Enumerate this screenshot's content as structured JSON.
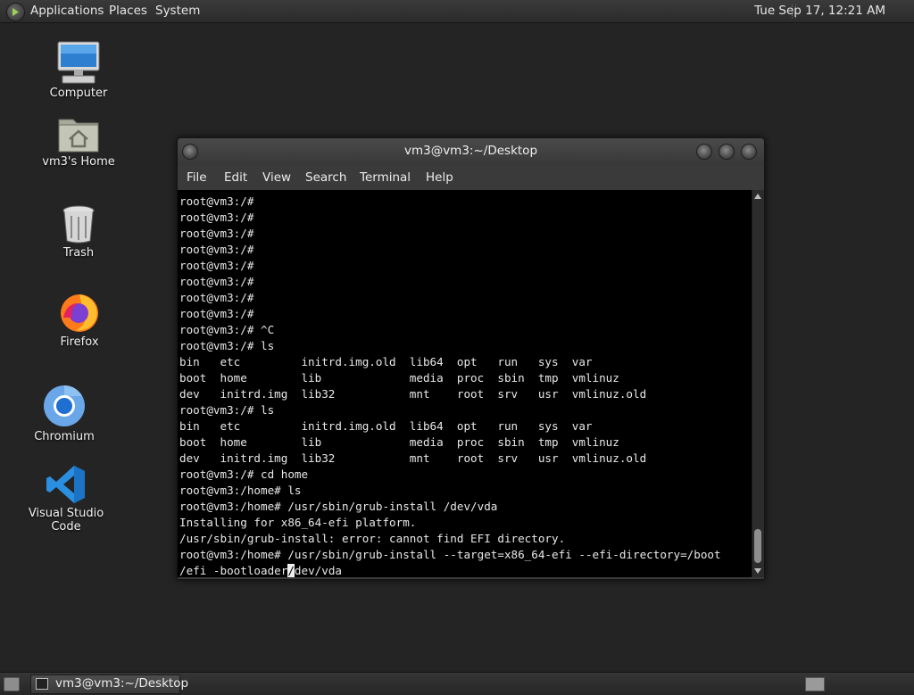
{
  "top_panel": {
    "menus": [
      "Applications",
      "Places",
      "System"
    ],
    "clock": "Tue Sep 17, 12:21 AM"
  },
  "desktop": {
    "icons": [
      {
        "label": "Computer",
        "icon": "computer-icon"
      },
      {
        "label": "vm3's Home",
        "icon": "home-folder-icon"
      },
      {
        "label": "Trash",
        "icon": "trash-icon"
      },
      {
        "label": "Firefox",
        "icon": "firefox-icon"
      },
      {
        "label": "Chromium",
        "icon": "chromium-icon"
      },
      {
        "label": "Visual Studio Code",
        "icon": "vscode-icon"
      }
    ]
  },
  "terminal": {
    "title": "vm3@vm3:~/Desktop",
    "menu": [
      "File",
      "Edit",
      "View",
      "Search",
      "Terminal",
      "Help"
    ],
    "lines": [
      "root@vm3:/#",
      "root@vm3:/#",
      "root@vm3:/#",
      "root@vm3:/#",
      "root@vm3:/#",
      "root@vm3:/#",
      "root@vm3:/#",
      "root@vm3:/#",
      "root@vm3:/# ^C",
      "root@vm3:/# ls",
      "bin   etc         initrd.img.old  lib64  opt   run   sys  var",
      "boot  home        lib             media  proc  sbin  tmp  vmlinuz",
      "dev   initrd.img  lib32           mnt    root  srv   usr  vmlinuz.old",
      "root@vm3:/# ls",
      "bin   etc         initrd.img.old  lib64  opt   run   sys  var",
      "boot  home        lib             media  proc  sbin  tmp  vmlinuz",
      "dev   initrd.img  lib32           mnt    root  srv   usr  vmlinuz.old",
      "root@vm3:/# cd home",
      "root@vm3:/home# ls",
      "root@vm3:/home# /usr/sbin/grub-install /dev/vda",
      "Installing for x86_64-efi platform.",
      "/usr/sbin/grub-install: error: cannot find EFI directory.",
      "root@vm3:/home# /usr/sbin/grub-install --target=x86_64-efi --efi-directory=/boot"
    ],
    "input_line": {
      "before_cursor": "/efi -bootloader",
      "cursor_char": "/",
      "after_cursor": "dev/vda"
    }
  },
  "taskbar": {
    "window_button": "vm3@vm3:~/Desktop"
  }
}
